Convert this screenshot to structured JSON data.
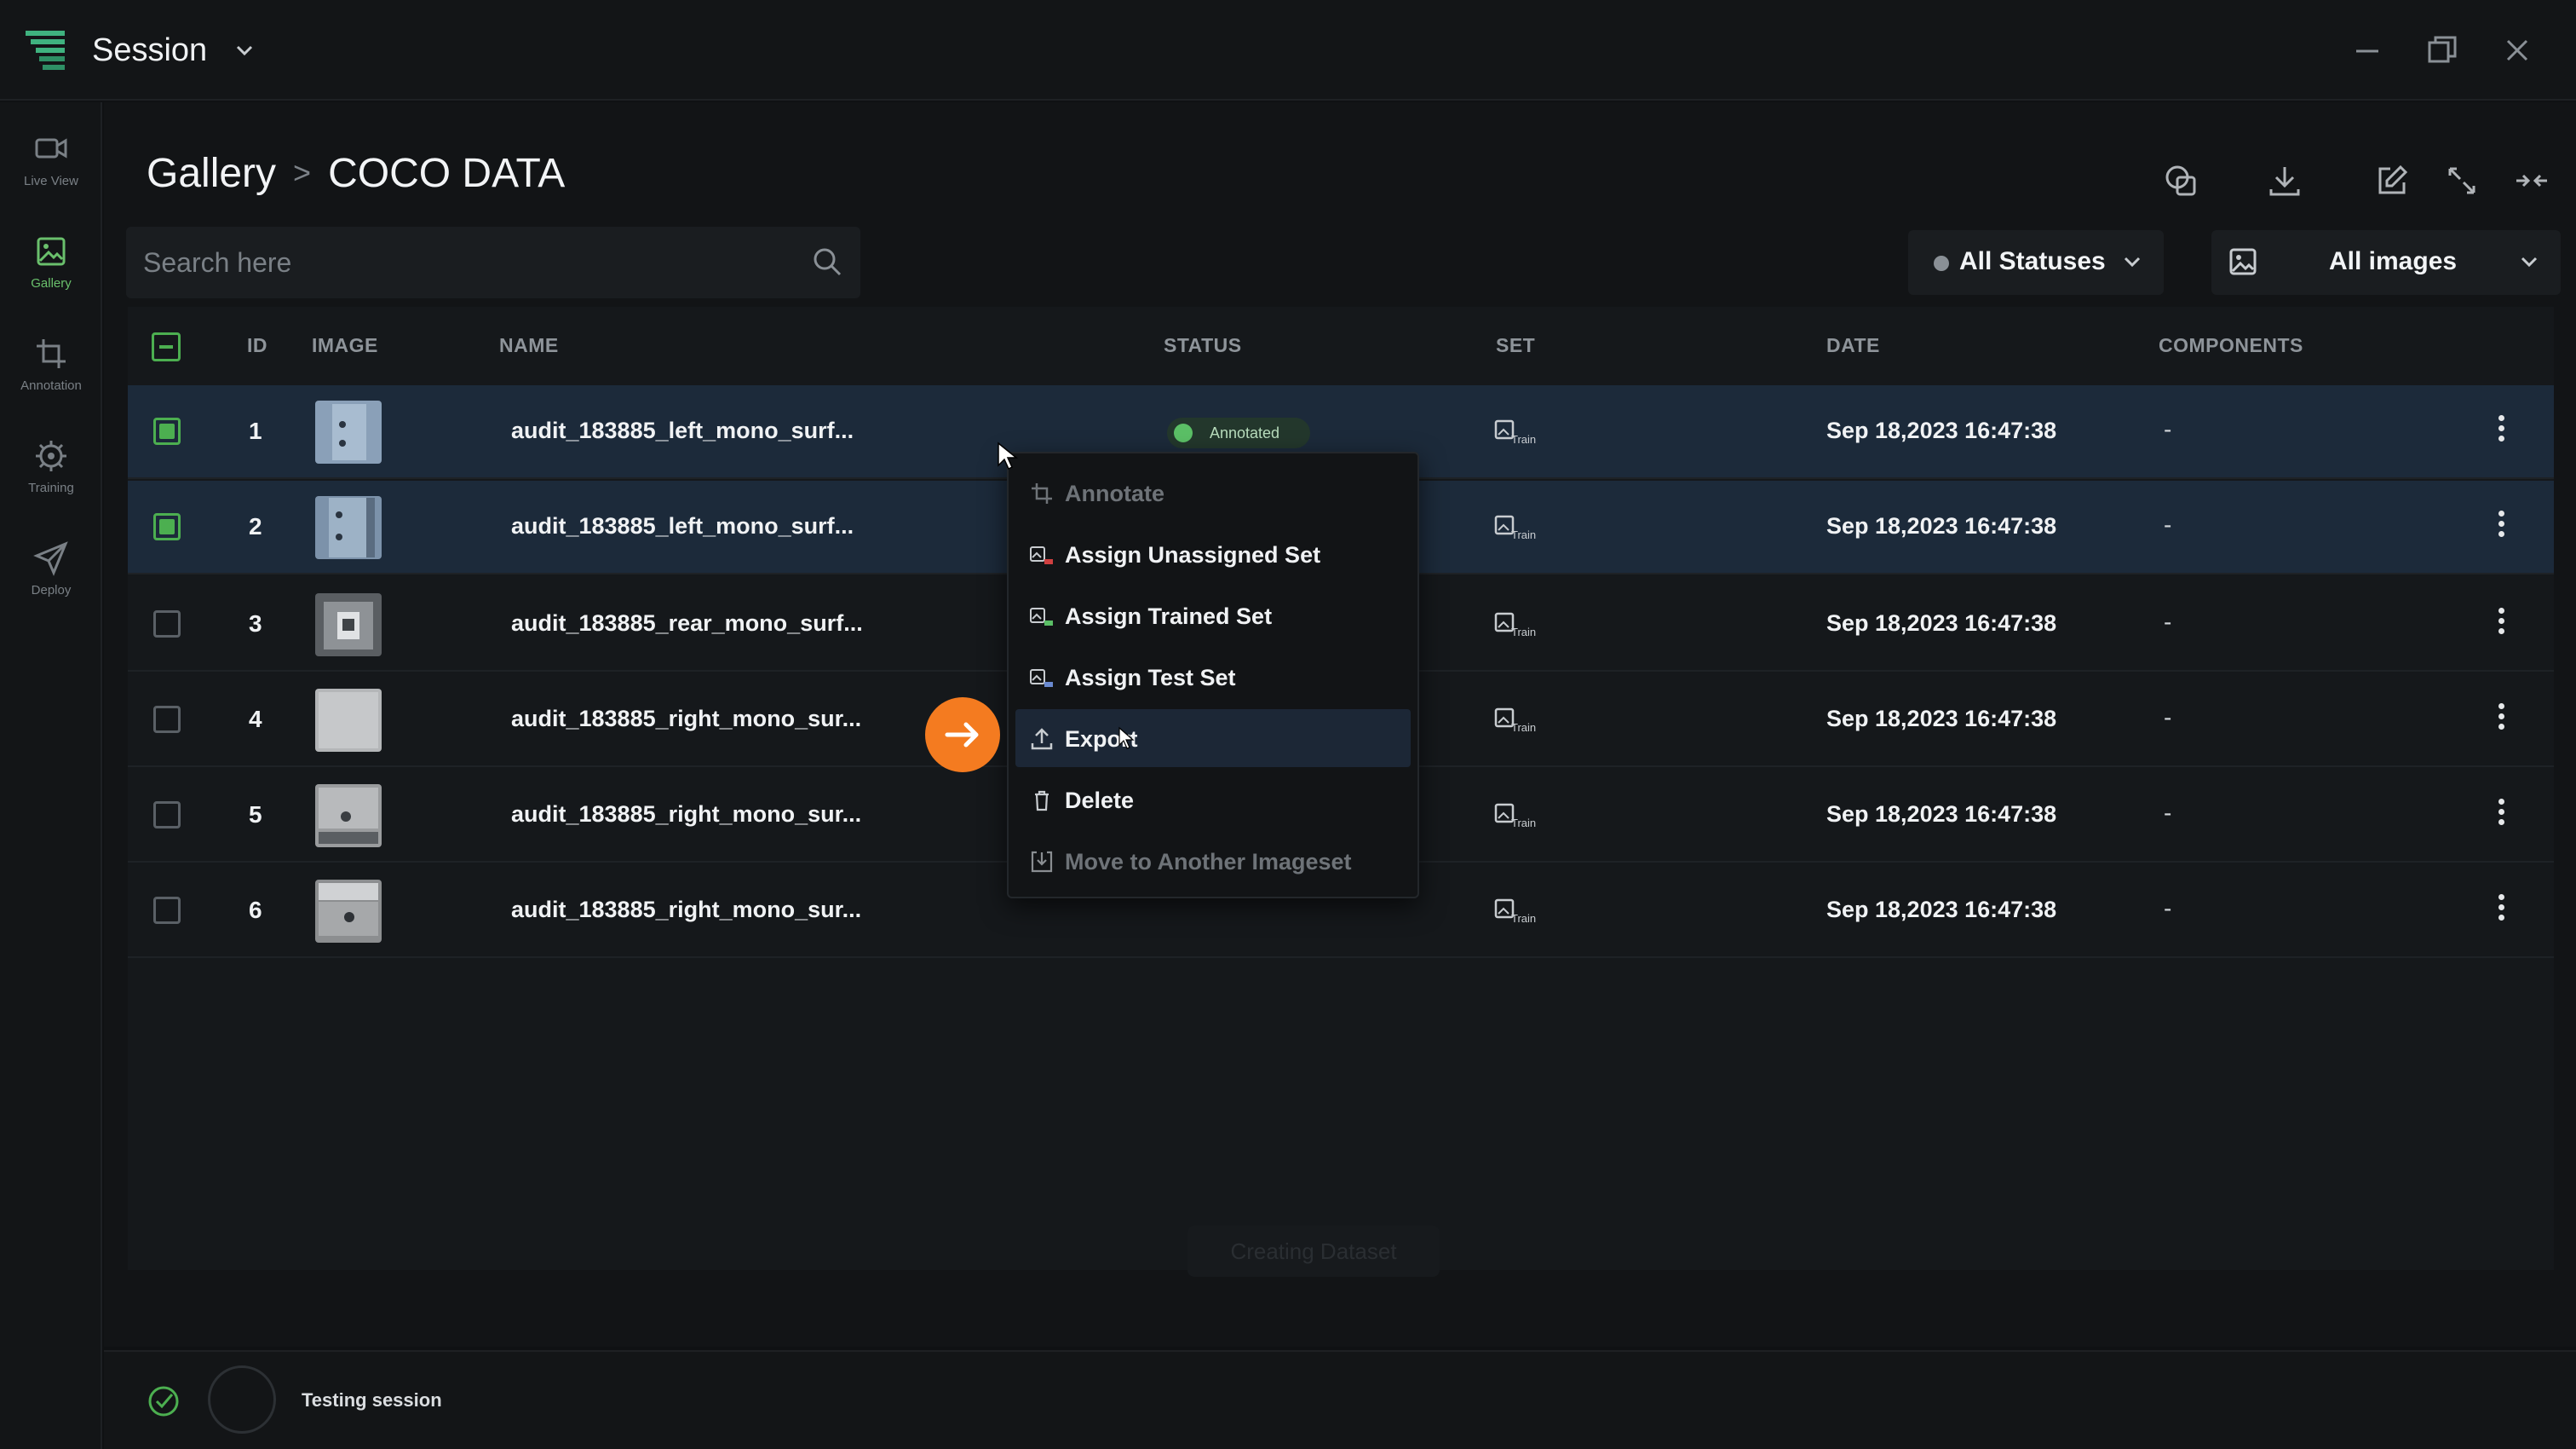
{
  "window": {
    "title": "Session"
  },
  "sidebar": {
    "items": [
      {
        "label": "Live View",
        "icon": "video-camera-icon"
      },
      {
        "label": "Gallery",
        "icon": "image-icon"
      },
      {
        "label": "Annotation",
        "icon": "crop-icon"
      },
      {
        "label": "Training",
        "icon": "gear-chip-icon"
      },
      {
        "label": "Deploy",
        "icon": "send-icon"
      }
    ],
    "active": "Gallery"
  },
  "breadcrumb": {
    "root": "Gallery",
    "separator": ">",
    "current": "COCO DATA"
  },
  "search": {
    "placeholder": "Search here"
  },
  "filters": {
    "status_label": "All Statuses",
    "images_label": "All images"
  },
  "table": {
    "columns": [
      "ID",
      "IMAGE",
      "NAME",
      "STATUS",
      "SET",
      "DATE",
      "COMPONENTS"
    ],
    "rows": [
      {
        "id": "1",
        "name": "audit_183885_left_mono_surf...",
        "status": "Annotated",
        "set": "Train",
        "date": "Sep 18,2023 16:47:38",
        "components": "-",
        "selected": true
      },
      {
        "id": "2",
        "name": "audit_183885_left_mono_surf...",
        "status": "",
        "set": "Train",
        "date": "Sep 18,2023 16:47:38",
        "components": "-",
        "selected": true
      },
      {
        "id": "3",
        "name": "audit_183885_rear_mono_surf...",
        "status": "",
        "set": "Train",
        "date": "Sep 18,2023 16:47:38",
        "components": "-",
        "selected": false
      },
      {
        "id": "4",
        "name": "audit_183885_right_mono_sur...",
        "status": "",
        "set": "Train",
        "date": "Sep 18,2023 16:47:38",
        "components": "-",
        "selected": false
      },
      {
        "id": "5",
        "name": "audit_183885_right_mono_sur...",
        "status": "",
        "set": "Train",
        "date": "Sep 18,2023 16:47:38",
        "components": "-",
        "selected": false
      },
      {
        "id": "6",
        "name": "audit_183885_right_mono_sur...",
        "status": "",
        "set": "Train",
        "date": "Sep 18,2023 16:47:38",
        "components": "-",
        "selected": false
      }
    ]
  },
  "context_menu": {
    "items": [
      {
        "label": "Annotate",
        "icon": "crop-icon",
        "disabled": true
      },
      {
        "label": "Assign Unassigned Set",
        "icon": "set-icon",
        "disabled": false
      },
      {
        "label": "Assign Trained Set",
        "icon": "set-icon",
        "disabled": false
      },
      {
        "label": "Assign Test Set",
        "icon": "set-icon",
        "disabled": false
      },
      {
        "label": "Export",
        "icon": "upload-icon",
        "disabled": false,
        "hovered": true
      },
      {
        "label": "Delete",
        "icon": "trash-icon",
        "disabled": false
      },
      {
        "label": "Move to Another Imageset",
        "icon": "move-icon",
        "disabled": true
      }
    ]
  },
  "background_button": {
    "label": "Creating Dataset"
  },
  "footer": {
    "status_text": "Testing session"
  },
  "colors": {
    "accent_green": "#4caf50",
    "highlight_orange": "#f47b20",
    "selected_row": "#1c2a3a"
  }
}
